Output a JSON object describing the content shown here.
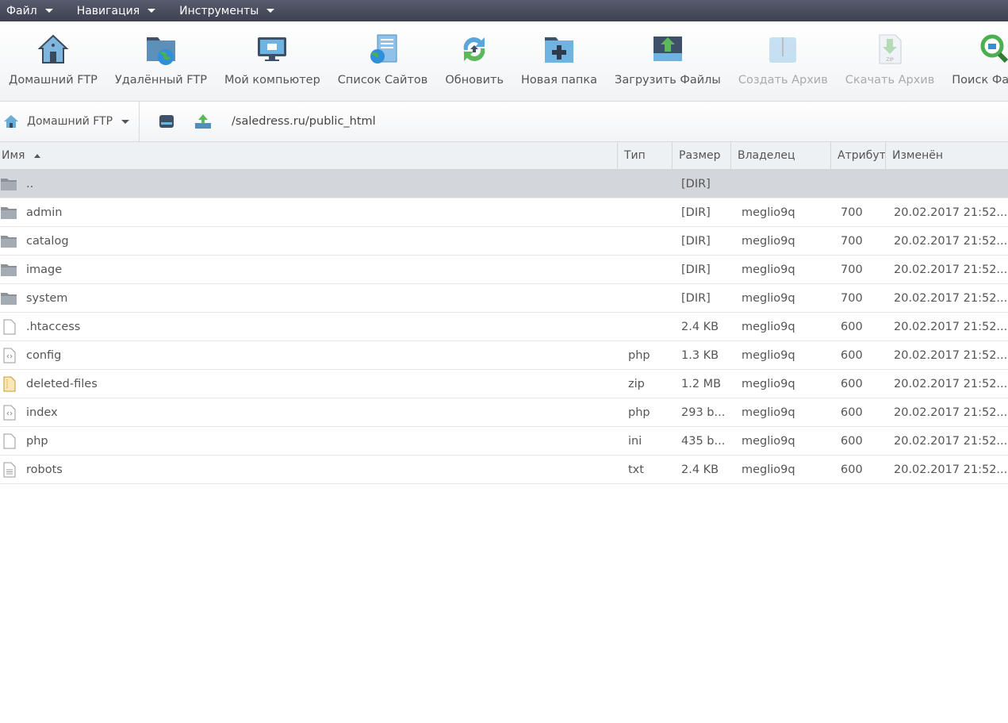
{
  "menu": [
    "Файл",
    "Навигация",
    "Инструменты"
  ],
  "toolbar": [
    {
      "label": "Домашний FTP",
      "icon": "home-icon",
      "disabled": false
    },
    {
      "label": "Удалённый FTP",
      "icon": "remote-folder-globe-icon",
      "disabled": false
    },
    {
      "label": "Мой компьютер",
      "icon": "monitor-icon",
      "disabled": false
    },
    {
      "label": "Список Сайтов",
      "icon": "site-list-icon",
      "disabled": false
    },
    {
      "label": "Обновить",
      "icon": "refresh-icon",
      "disabled": false
    },
    {
      "label": "Новая папка",
      "icon": "new-folder-icon",
      "disabled": false
    },
    {
      "label": "Загрузить Файлы",
      "icon": "upload-icon",
      "disabled": false
    },
    {
      "label": "Создать Архив",
      "icon": "archive-icon",
      "disabled": true
    },
    {
      "label": "Скачать Архив",
      "icon": "download-zip-icon",
      "disabled": true
    },
    {
      "label": "Поиск Файлов",
      "icon": "search-files-icon",
      "disabled": false
    }
  ],
  "pathbar": {
    "site": "Домашний FTP",
    "path": "/saledress.ru/public_html"
  },
  "columns": [
    "Имя",
    "Тип",
    "Размер",
    "Владелец",
    "Атрибуты",
    "Изменён"
  ],
  "rows": [
    {
      "name": "..",
      "type": "",
      "size": "[DIR]",
      "owner": "",
      "attr": "",
      "modified": "",
      "icon": "folder",
      "selected": true
    },
    {
      "name": "admin",
      "type": "",
      "size": "[DIR]",
      "owner": "meglio9q",
      "attr": "700",
      "modified": "20.02.2017 21:52...",
      "icon": "folder"
    },
    {
      "name": "catalog",
      "type": "",
      "size": "[DIR]",
      "owner": "meglio9q",
      "attr": "700",
      "modified": "20.02.2017 21:52...",
      "icon": "folder"
    },
    {
      "name": "image",
      "type": "",
      "size": "[DIR]",
      "owner": "meglio9q",
      "attr": "700",
      "modified": "20.02.2017 21:52...",
      "icon": "folder"
    },
    {
      "name": "system",
      "type": "",
      "size": "[DIR]",
      "owner": "meglio9q",
      "attr": "700",
      "modified": "20.02.2017 21:52...",
      "icon": "folder"
    },
    {
      "name": ".htaccess",
      "type": "",
      "size": "2.4 KB",
      "owner": "meglio9q",
      "attr": "600",
      "modified": "20.02.2017 21:52...",
      "icon": "file"
    },
    {
      "name": "config",
      "type": "php",
      "size": "1.3 KB",
      "owner": "meglio9q",
      "attr": "600",
      "modified": "20.02.2017 21:52...",
      "icon": "code"
    },
    {
      "name": "deleted-files",
      "type": "zip",
      "size": "1.2 MB",
      "owner": "meglio9q",
      "attr": "600",
      "modified": "20.02.2017 21:52...",
      "icon": "zip"
    },
    {
      "name": "index",
      "type": "php",
      "size": "293 b...",
      "owner": "meglio9q",
      "attr": "600",
      "modified": "20.02.2017 21:52...",
      "icon": "code"
    },
    {
      "name": "php",
      "type": "ini",
      "size": "435 b...",
      "owner": "meglio9q",
      "attr": "600",
      "modified": "20.02.2017 21:52...",
      "icon": "file"
    },
    {
      "name": "robots",
      "type": "txt",
      "size": "2.4 KB",
      "owner": "meglio9q",
      "attr": "600",
      "modified": "20.02.2017 21:52...",
      "icon": "text"
    }
  ]
}
